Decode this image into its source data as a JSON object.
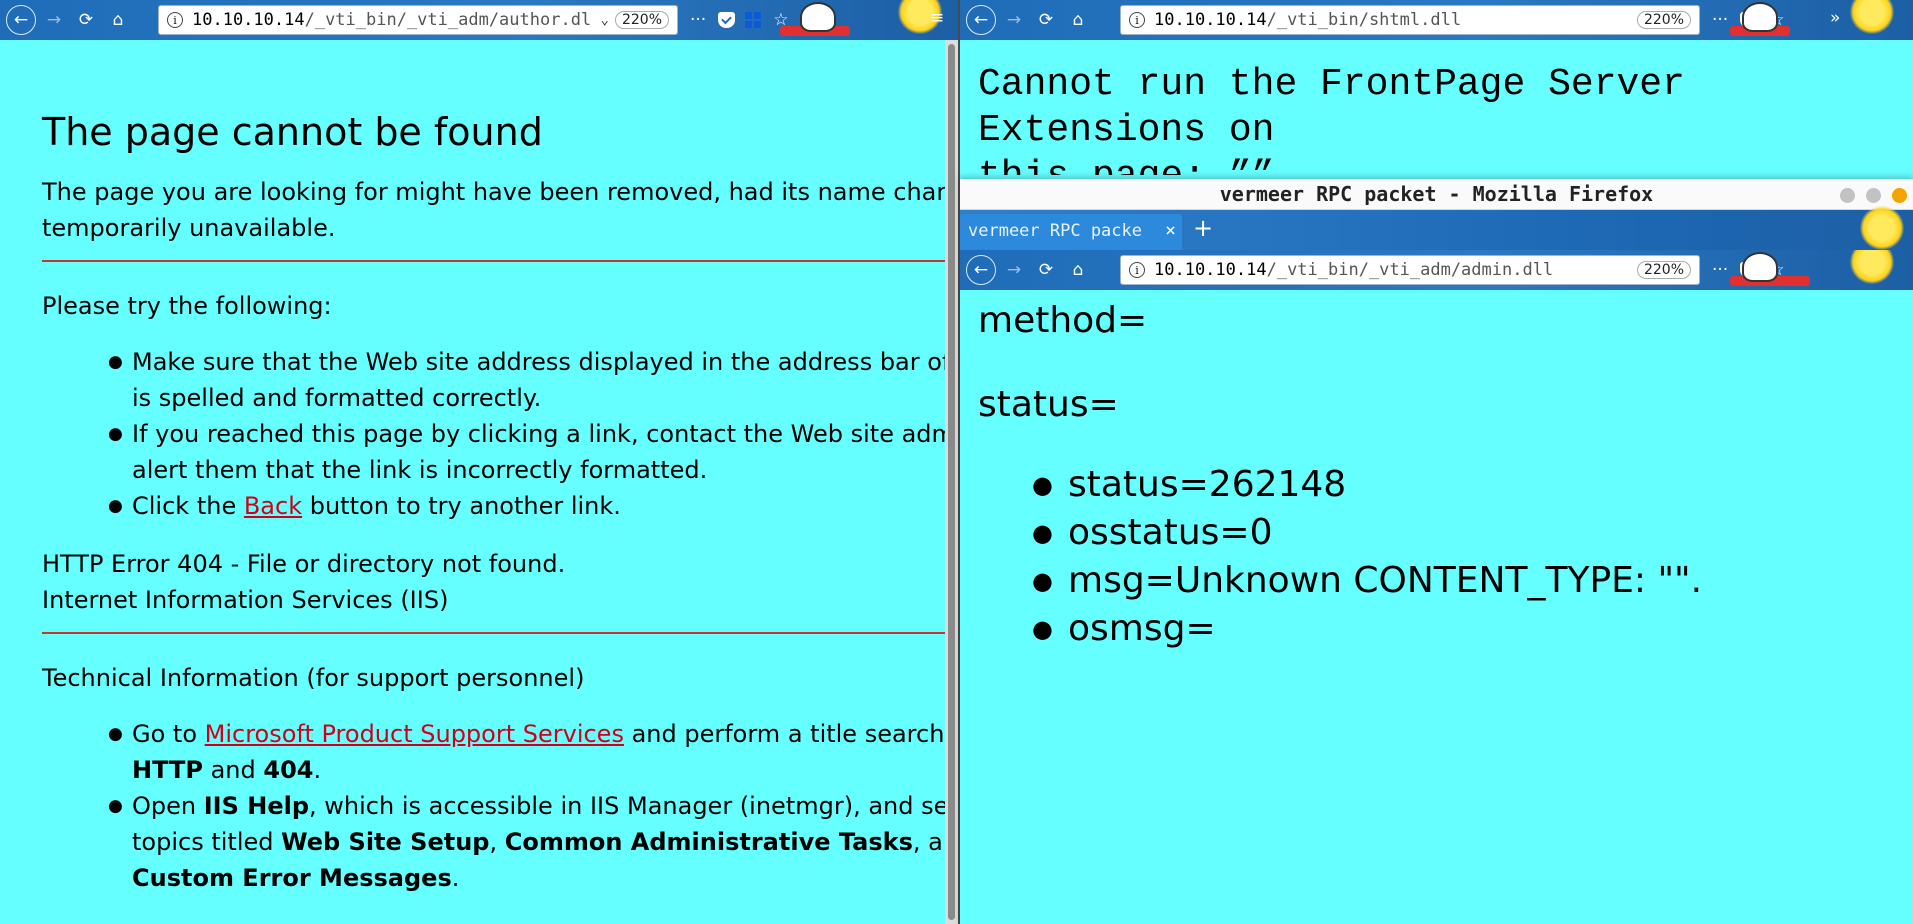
{
  "left_window": {
    "url_host": "10.10.10.14",
    "url_path": "/_vti_bin/_vti_adm/author.dl",
    "zoom": "220%",
    "page": {
      "title": "The page cannot be found",
      "lead_line1": "The page you are looking for might have been removed, had its name chang",
      "lead_line2": "temporarily unavailable.",
      "try_heading": "Please try the following:",
      "tips": {
        "t1_line1": "Make sure that the Web site address displayed in the address bar of",
        "t1_line2": "is spelled and formatted correctly.",
        "t2_line1": "If you reached this page by clicking a link, contact the Web site adm",
        "t2_line2": "alert them that the link is incorrectly formatted.",
        "t3_pre": "Click the ",
        "t3_link": "Back",
        "t3_post": " button to try another link."
      },
      "error_line1": "HTTP Error 404 - File or directory not found.",
      "error_line2": "Internet Information Services (IIS)",
      "tech_heading": "Technical Information (for support personnel)",
      "tech": {
        "a_pre": "Go to ",
        "a_link": "Microsoft Product Support Services",
        "a_post": " and perform a title search f",
        "a_b1": "HTTP",
        "a_and": " and ",
        "a_b2": "404",
        "a_end": ".",
        "b_pre": "Open ",
        "b_b1": "IIS Help",
        "b_post": ", which is accessible in IIS Manager (inetmgr), and se",
        "b_l2_pre": "topics titled ",
        "b_b2": "Web Site Setup",
        "b_comma": ", ",
        "b_b3": "Common Administrative Tasks",
        "b_l2_post": ", ar",
        "b_b4": "Custom Error Messages",
        "b_end": "."
      }
    }
  },
  "right_window": {
    "url_host": "10.10.10.14",
    "url_path": "/_vti_bin/shtml.dll",
    "zoom": "220%",
    "message_line1": "Cannot run the FrontPage Server Extensions on",
    "message_line2": "this page: ””"
  },
  "popup_window": {
    "title": "vermeer RPC packet - Mozilla Firefox",
    "tab_label": "vermeer RPC packe",
    "tab_close": "×",
    "new_tab": "+",
    "url_host": "10.10.10.14",
    "url_path": "/_vti_bin/_vti_adm/admin.dll",
    "zoom": "220%",
    "method_line": "method=",
    "status_line": "status=",
    "items": [
      "status=262148",
      "osstatus=0",
      "msg=Unknown CONTENT_TYPE: \"\".",
      "osmsg="
    ]
  },
  "icons": {
    "back": "←",
    "forward": "→",
    "reload": "⟳",
    "home": "⌂",
    "more": "···",
    "star": "☆",
    "overflow": "»",
    "menu": "≡",
    "info": "i",
    "chevron": "⌄"
  },
  "colors": {
    "page_bg": "#66ffff",
    "toolbar": "#1f6cb8",
    "link": "#d0001a",
    "rule": "#c0392b",
    "traffic": [
      "#c2c2c2",
      "#c2c2c2",
      "#f4a300"
    ]
  }
}
